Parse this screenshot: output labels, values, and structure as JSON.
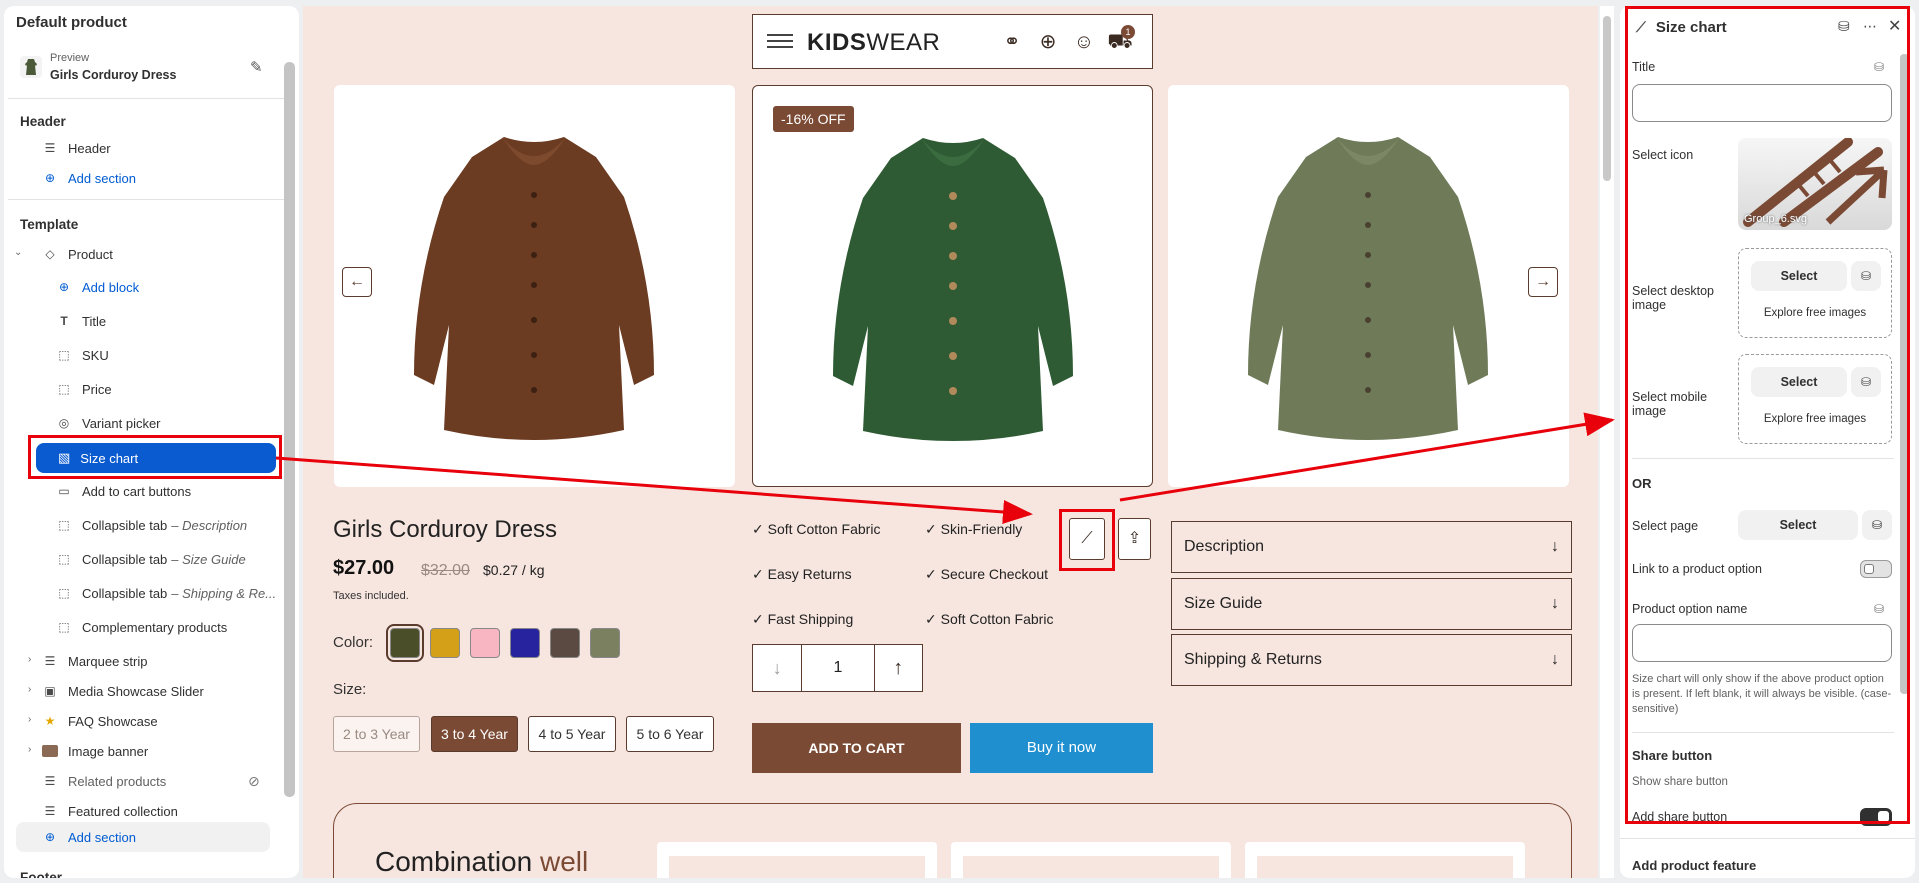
{
  "left_panel": {
    "title": "Default product",
    "preview_label": "Preview",
    "preview_product": "Girls Corduroy Dress",
    "header_section": "Header",
    "header_item": "Header",
    "add_section_1": "Add section",
    "template_section": "Template",
    "product_item": "Product",
    "add_block": "Add block",
    "blocks": [
      {
        "label": "Title",
        "icon": "text-icon"
      },
      {
        "label": "SKU",
        "icon": "dashed-square-icon"
      },
      {
        "label": "Price",
        "icon": "dashed-square-icon"
      },
      {
        "label": "Variant picker",
        "icon": "variant-icon"
      },
      {
        "label": "Size chart",
        "icon": "ruler-icon"
      },
      {
        "label": "Add to cart buttons",
        "icon": "cart-buttons-icon"
      },
      {
        "label": "Collapsible tab",
        "sub": "– Description",
        "icon": "dashed-square-icon"
      },
      {
        "label": "Collapsible tab",
        "sub": "– Size Guide",
        "icon": "dashed-square-icon"
      },
      {
        "label": "Collapsible tab",
        "sub": "– Shipping & Re...",
        "icon": "dashed-square-icon"
      },
      {
        "label": "Complementary products",
        "icon": "dashed-square-icon"
      }
    ],
    "sections": [
      {
        "label": "Marquee strip"
      },
      {
        "label": "Media Showcase Slider"
      },
      {
        "label": "FAQ Showcase"
      },
      {
        "label": "Image banner"
      },
      {
        "label": "Related products"
      },
      {
        "label": "Featured collection"
      }
    ],
    "add_section_2": "Add section",
    "footer_partial": "Footer"
  },
  "storefront": {
    "logo_bold": "KIDS",
    "logo_light": "WEAR",
    "cart_count": "1",
    "sale_badge": "-16% OFF",
    "product_title": "Girls Corduroy Dress",
    "price": "$27.00",
    "compare_price": "$32.00",
    "unit_price": "$0.27 / kg",
    "taxes": "Taxes included.",
    "color_label": "Color:",
    "colors": [
      "#4a4f2a",
      "#d4a017",
      "#f7b6c2",
      "#27229e",
      "#5a4a42",
      "#7a8060"
    ],
    "size_label": "Size:",
    "sizes": [
      "2 to 3 Year",
      "3 to 4 Year",
      "4 to 5 Year",
      "5 to 6 Year"
    ],
    "features": [
      "✓ Soft Cotton Fabric",
      "✓ Skin-Friendly",
      "✓ Easy Returns",
      "✓ Secure Checkout",
      "✓ Fast Shipping",
      "✓ Soft Cotton Fabric"
    ],
    "quantity": "1",
    "add_to_cart": "ADD TO CART",
    "buy_now": "Buy it now",
    "accordions": [
      "Description",
      "Size Guide",
      "Shipping & Returns"
    ],
    "combo_title_1": "Combination",
    "combo_title_2": "well",
    "dress_colors": [
      "#6b3b22",
      "#2f5b34",
      "#6f7a58"
    ]
  },
  "right_panel": {
    "title": "Size chart",
    "title_label": "Title",
    "title_value": "",
    "select_icon_label": "Select icon",
    "icon_filename": "Group_6.svg",
    "desktop_image_label_1": "Select desktop",
    "desktop_image_label_2": "image",
    "mobile_image_label_1": "Select mobile",
    "mobile_image_label_2": "image",
    "select": "Select",
    "explore": "Explore free images",
    "or": "OR",
    "select_page_label": "Select page",
    "link_option_label": "Link to a product option",
    "link_option_enabled": false,
    "option_name_label": "Product option name",
    "option_name_value": "",
    "help_text": "Size chart will only show if the above product option is present. If left blank, it will always be visible. (case-sensitive)",
    "share_heading": "Share button",
    "share_sub": "Show share button",
    "add_share_label": "Add share button",
    "add_share_enabled": true,
    "next_section": "Add product feature"
  }
}
